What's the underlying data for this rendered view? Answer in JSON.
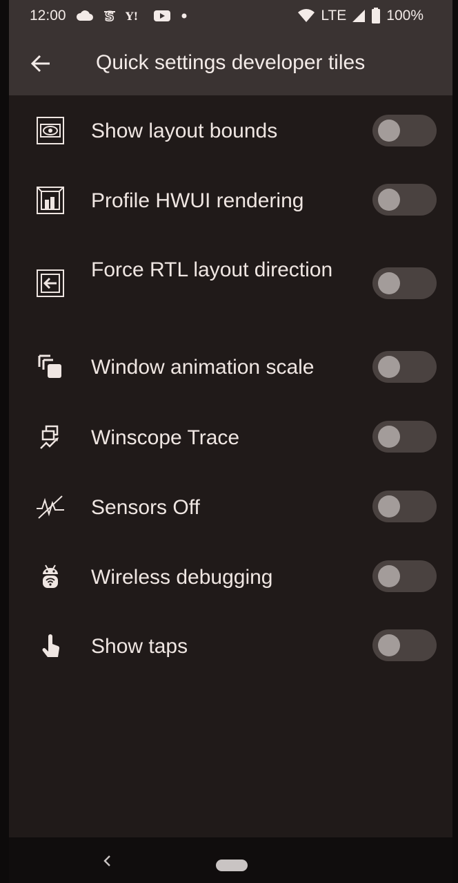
{
  "status_bar": {
    "time": "12:00",
    "network": "LTE",
    "battery": "100%",
    "left_icons": [
      "cloud-icon",
      "s-app-icon",
      "yahoo-icon",
      "youtube-icon",
      "dot-icon"
    ],
    "right_icons": [
      "wifi-icon",
      "signal-icon",
      "battery-icon"
    ]
  },
  "header": {
    "title": "Quick settings developer tiles",
    "back_icon": "arrow-back-icon"
  },
  "tiles": [
    {
      "label": "Show layout bounds",
      "icon": "layout-bounds-icon",
      "enabled": false
    },
    {
      "label": "Profile HWUI rendering",
      "icon": "hwui-rendering-icon",
      "enabled": false
    },
    {
      "label": "Force RTL layout direction",
      "icon": "rtl-layout-icon",
      "enabled": false
    },
    {
      "label": "Window animation scale",
      "icon": "window-animation-icon",
      "enabled": false
    },
    {
      "label": "Winscope Trace",
      "icon": "winscope-trace-icon",
      "enabled": false
    },
    {
      "label": "Sensors Off",
      "icon": "sensors-off-icon",
      "enabled": false
    },
    {
      "label": "Wireless debugging",
      "icon": "wireless-debugging-icon",
      "enabled": false
    },
    {
      "label": "Show taps",
      "icon": "show-taps-icon",
      "enabled": false
    }
  ],
  "nav_bar": {
    "back_icon": "nav-back-icon",
    "home_icon": "home-pill-icon"
  },
  "colors": {
    "background": "#201a19",
    "app_bar": "#3a3332",
    "text": "#efe6e2",
    "toggle_track": "#4a4240",
    "toggle_knob": "#a39c9a"
  }
}
